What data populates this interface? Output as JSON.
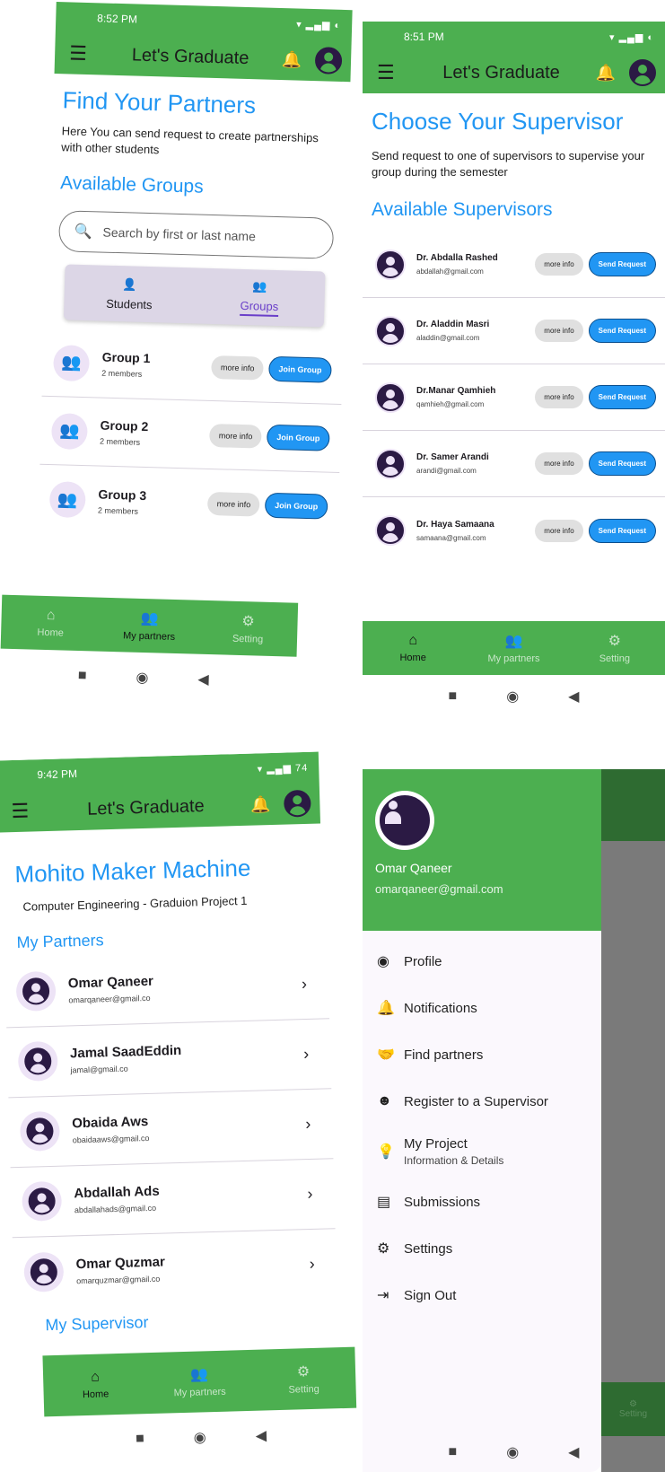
{
  "screens": {
    "find_partners": {
      "status_time": "8:52 PM",
      "app_title": "Let's Graduate",
      "heading": "Find Your Partners",
      "description": "Here You can send request to create partnerships with other students",
      "section_title": "Available Groups",
      "search_placeholder": "Search by first or last name",
      "tabs": [
        {
          "label": "Students"
        },
        {
          "label": "Groups"
        }
      ],
      "groups": [
        {
          "name": "Group 1",
          "members": "2 members",
          "info_label": "more info",
          "action_label": "Join Group"
        },
        {
          "name": "Group 2",
          "members": "2 members",
          "info_label": "more info",
          "action_label": "Join Group"
        },
        {
          "name": "Group 3",
          "members": "2 members",
          "info_label": "more info",
          "action_label": "Join Group"
        }
      ],
      "nav": [
        {
          "label": "Home"
        },
        {
          "label": "My partners"
        },
        {
          "label": "Setting"
        }
      ]
    },
    "supervisor": {
      "status_time": "8:51 PM",
      "app_title": "Let's Graduate",
      "heading": "Choose Your Supervisor",
      "description": "Send request to one of supervisors to supervise your group during the semester",
      "section_title": "Available Supervisors",
      "supervisors": [
        {
          "name": "Dr. Abdalla Rashed",
          "email": "abdallah@gmail.com",
          "info_label": "more info",
          "action_label": "Send Request"
        },
        {
          "name": "Dr. Aladdin Masri",
          "email": "aladdin@gmail.com",
          "info_label": "more info",
          "action_label": "Send Request"
        },
        {
          "name": "Dr.Manar Qamhieh",
          "email": "qamhieh@gmail.com",
          "info_label": "more info",
          "action_label": "Send Request"
        },
        {
          "name": "Dr. Samer Arandi",
          "email": "arandi@gmail.com",
          "info_label": "more info",
          "action_label": "Send Request"
        },
        {
          "name": "Dr. Haya Samaana",
          "email": "samaana@gmail.com",
          "info_label": "more info",
          "action_label": "Send Request"
        }
      ],
      "nav": [
        {
          "label": "Home"
        },
        {
          "label": "My partners"
        },
        {
          "label": "Setting"
        }
      ]
    },
    "my_partners": {
      "status_time": "9:42 PM",
      "battery": "74",
      "app_title": "Let's Graduate",
      "heading": "Mohito Maker Machine",
      "description": "Computer Engineering - Graduion Project 1",
      "section_title": "My Partners",
      "partners": [
        {
          "name": "Omar Qaneer",
          "email": "omarqaneer@gmail.co"
        },
        {
          "name": "Jamal SaadEddin",
          "email": "jamal@gmail.co"
        },
        {
          "name": "Obaida Aws",
          "email": "obaidaaws@gmail.co"
        },
        {
          "name": "Abdallah Ads",
          "email": "abdallahads@gmail.co"
        },
        {
          "name": "Omar Quzmar",
          "email": "omarquzmar@gmail.co"
        }
      ],
      "supervisor_title": "My Supervisor",
      "nav": [
        {
          "label": "Home"
        },
        {
          "label": "My partners"
        },
        {
          "label": "Setting"
        }
      ]
    },
    "drawer": {
      "user_name": "Omar Qaneer",
      "user_email": "omarqaneer@gmail.com",
      "items": [
        {
          "label": "Profile",
          "icon": "account-circle-icon"
        },
        {
          "label": "Notifications",
          "icon": "bell-icon"
        },
        {
          "label": "Find partners",
          "icon": "handshake-icon"
        },
        {
          "label": "Register to a Supervisor",
          "icon": "supervisor-icon"
        },
        {
          "label": "My Project",
          "sub": "Information & Details",
          "icon": "lightbulb-icon"
        },
        {
          "label": "Submissions",
          "icon": "pdf-icon"
        },
        {
          "label": "Settings",
          "icon": "gear-icon"
        },
        {
          "label": "Sign Out",
          "icon": "logout-icon"
        }
      ],
      "nav_hint": "Setting"
    }
  }
}
